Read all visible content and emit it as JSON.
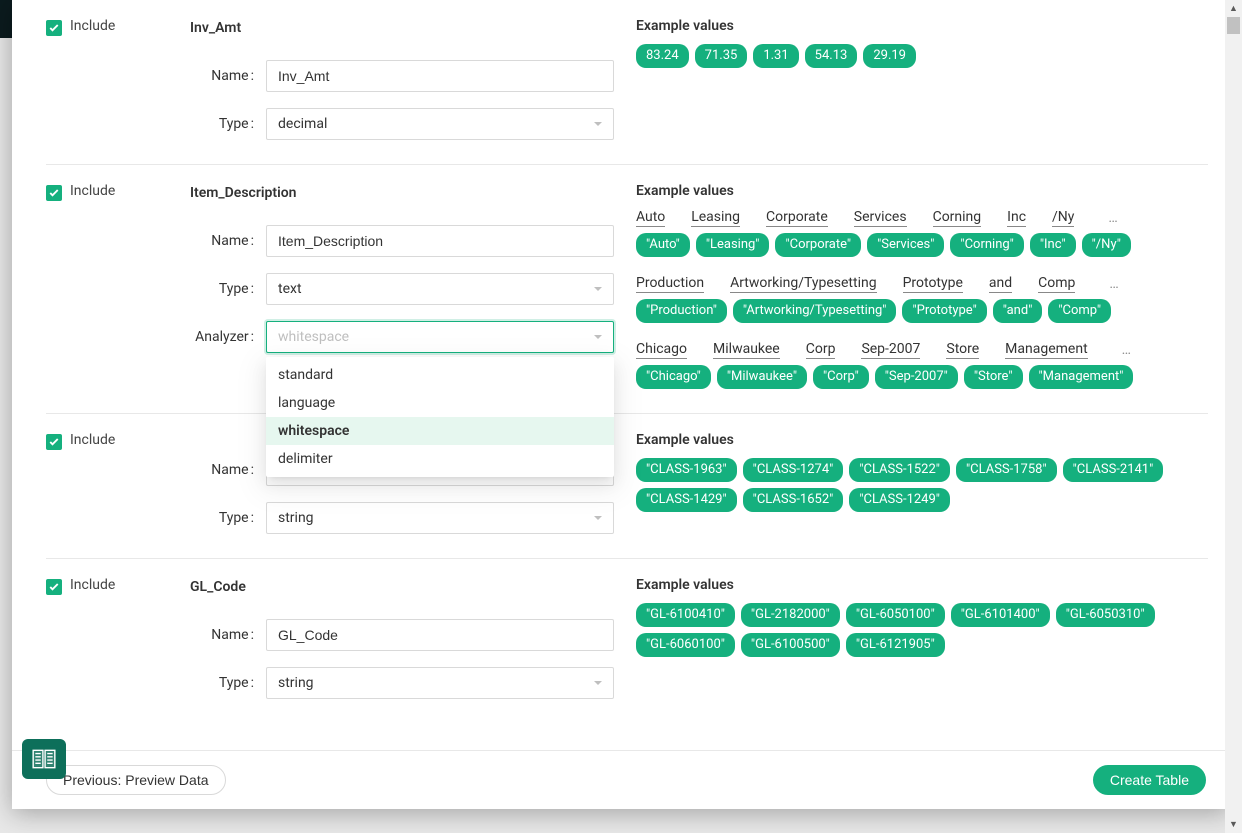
{
  "common": {
    "include_label": "Include",
    "name_label": "Name",
    "type_label": "Type",
    "analyzer_label": "Analyzer",
    "example_values_label": "Example values",
    "ellipsis": "…"
  },
  "analyzer_dropdown": {
    "placeholder": "whitespace",
    "selected": "whitespace",
    "options": [
      "standard",
      "language",
      "whitespace",
      "delimiter"
    ]
  },
  "fields": [
    {
      "key": "inv_amt",
      "title": "Inv_Amt",
      "name": "Inv_Amt",
      "type": "decimal",
      "example_pills": [
        "83.24",
        "71.35",
        "1.31",
        "54.13",
        "29.19"
      ]
    },
    {
      "key": "item_description",
      "title": "Item_Description",
      "name": "Item_Description",
      "type": "text",
      "analyzer_open": true,
      "token_examples": [
        {
          "words": [
            "Auto",
            "Leasing",
            "Corporate",
            "Services",
            "Corning",
            "Inc",
            "/Ny"
          ],
          "pills": [
            "\"Auto\"",
            "\"Leasing\"",
            "\"Corporate\"",
            "\"Services\"",
            "\"Corning\"",
            "\"Inc\"",
            "\"/Ny\""
          ],
          "truncated": true
        },
        {
          "words": [
            "Production",
            "Artworking/Typesetting",
            "Prototype",
            "and",
            "Comp"
          ],
          "pills": [
            "\"Production\"",
            "\"Artworking/Typesetting\"",
            "\"Prototype\"",
            "\"and\"",
            "\"Comp\""
          ],
          "truncated": true
        },
        {
          "words": [
            "Chicago",
            "Milwaukee",
            "Corp",
            "Sep-2007",
            "Store",
            "Management"
          ],
          "pills": [
            "\"Chicago\"",
            "\"Milwaukee\"",
            "\"Corp\"",
            "\"Sep-2007\"",
            "\"Store\"",
            "\"Management\""
          ],
          "truncated": true
        }
      ]
    },
    {
      "key": "hidden_by_dropdown",
      "title": "",
      "name": "",
      "type": "string",
      "example_pills": [
        "\"CLASS-1963\"",
        "\"CLASS-1274\"",
        "\"CLASS-1522\"",
        "\"CLASS-1758\"",
        "\"CLASS-2141\"",
        "\"CLASS-1429\"",
        "\"CLASS-1652\"",
        "\"CLASS-1249\""
      ]
    },
    {
      "key": "gl_code",
      "title": "GL_Code",
      "name": "GL_Code",
      "type": "string",
      "example_pills": [
        "\"GL-6100410\"",
        "\"GL-2182000\"",
        "\"GL-6050100\"",
        "\"GL-6101400\"",
        "\"GL-6050310\"",
        "\"GL-6060100\"",
        "\"GL-6100500\"",
        "\"GL-6121905\""
      ]
    }
  ],
  "footer": {
    "previous": "Previous: Preview Data",
    "create": "Create Table"
  }
}
